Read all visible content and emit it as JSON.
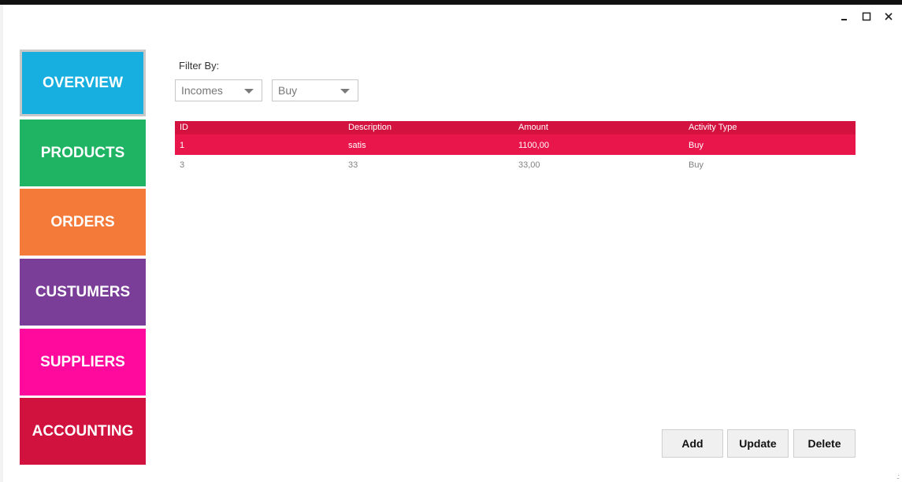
{
  "window": {
    "colors": {
      "top_border": "#111111",
      "background": "#ffffff"
    },
    "controls": [
      {
        "name": "minimize-icon",
        "glyph": "_"
      },
      {
        "name": "maximize-icon",
        "glyph": "□"
      },
      {
        "name": "close-icon",
        "glyph": "×"
      }
    ]
  },
  "nav": {
    "items": [
      {
        "label": "OVERVIEW",
        "color": "#17aee0",
        "active": true
      },
      {
        "label": "PRODUCTS",
        "color": "#1fb463"
      },
      {
        "label": "ORDERS",
        "color": "#f47a3a"
      },
      {
        "label": "CUSTUMERS",
        "color": "#7a3d98"
      },
      {
        "label": "SUPPLIERS",
        "color": "#ff0a9c"
      },
      {
        "label": "ACCOUNTING",
        "color": "#d1123f"
      }
    ]
  },
  "filter": {
    "label": "Filter By:",
    "type_value": "Incomes",
    "activity_value": "Buy"
  },
  "grid": {
    "columns": [
      "ID",
      "Description",
      "Amount",
      "Activity Type"
    ],
    "rows": [
      {
        "id": "1",
        "description": "satis",
        "amount": "1100,00",
        "activity_type": "Buy",
        "selected": true
      },
      {
        "id": "3",
        "description": "33",
        "amount": "33,00",
        "activity_type": "Buy",
        "selected": false
      }
    ],
    "colors": {
      "header": "#d3123f",
      "selected_row": "#e8164a"
    }
  },
  "actions": {
    "add_label": "Add",
    "update_label": "Update",
    "delete_label": "Delete"
  }
}
